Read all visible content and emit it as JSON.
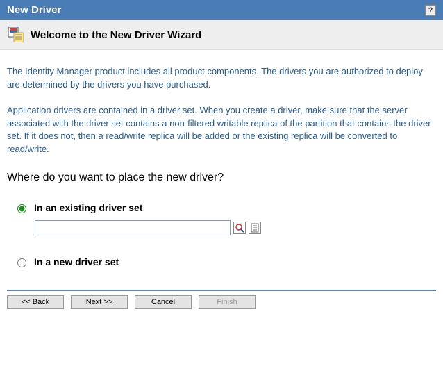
{
  "titlebar": {
    "title": "New Driver",
    "help_glyph": "?"
  },
  "subheader": {
    "title": "Welcome to the New Driver Wizard"
  },
  "intro": {
    "p1": "The Identity Manager product includes all product components.  The drivers you are authorized to deploy are determined by the drivers you have purchased.",
    "p2": "Application drivers are contained in a driver set. When you create a driver, make sure that the server associated with the driver set contains a non-filtered writable replica of the partition that contains the driver set.  If it does not, then a read/write replica will be added or the existing replica will be converted to read/write."
  },
  "question": "Where do you want to place the new driver?",
  "options": {
    "existing": {
      "label": "In an existing driver set",
      "value": "",
      "selected": true
    },
    "new": {
      "label": "In a new driver set",
      "selected": false
    }
  },
  "buttons": {
    "back": "<< Back",
    "next": "Next >>",
    "cancel": "Cancel",
    "finish": "Finish"
  }
}
